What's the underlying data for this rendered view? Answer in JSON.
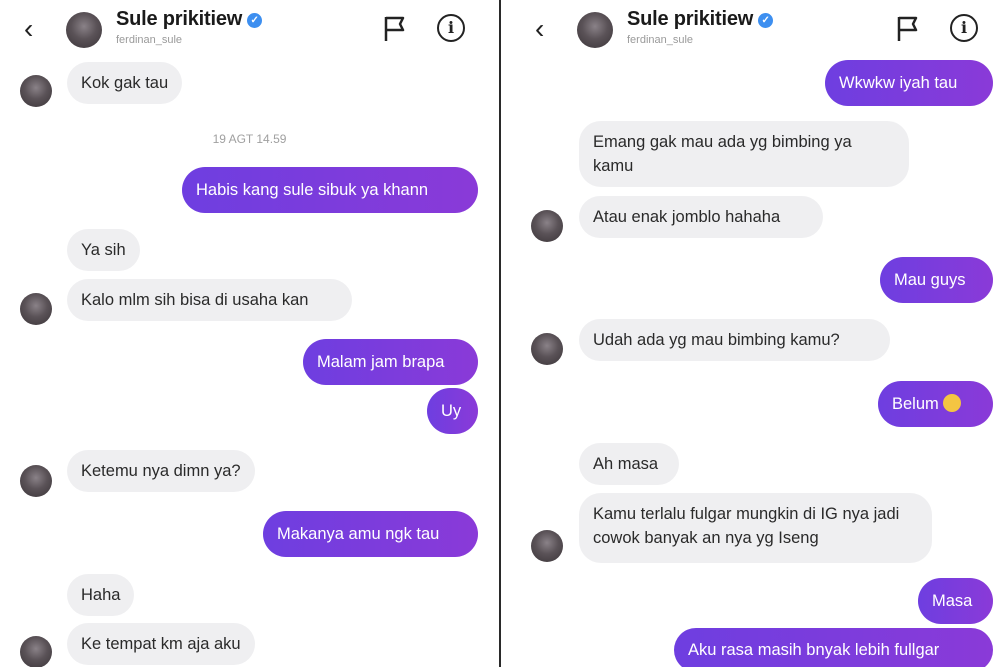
{
  "contact": {
    "name": "Sule prikitiew",
    "username": "ferdinan_sule",
    "verified_mark": "✓"
  },
  "icons": {
    "back": "back-chevron-icon",
    "flag": "flag-icon",
    "info": "info-icon",
    "back_glyph": "‹",
    "info_glyph": "i"
  },
  "colors": {
    "outgoing": "#7a3cdc",
    "incoming": "#efeff1",
    "verified": "#3d8ff0"
  },
  "left_panel": {
    "m1": "Kok gak tau",
    "timestamp": "19 AGT 14.59",
    "m2": "Habis kang sule sibuk ya khann",
    "m3": "Ya sih",
    "m4": "Kalo mlm sih bisa di usaha kan",
    "m5": "Malam jam brapa",
    "m6": "Uy",
    "m7": "Ketemu nya dimn ya?",
    "m8": "Makanya amu ngk tau",
    "m9": "Haha",
    "m10": "Ke tempat km aja aku"
  },
  "right_panel": {
    "m1": "Wkwkw iyah tau",
    "m2": "Emang gak mau ada yg bimbing ya kamu",
    "m3": "Atau enak jomblo hahaha",
    "m4": "Mau guys",
    "m5": "Udah ada yg mau bimbing kamu?",
    "m6": "Belum",
    "m7": "Ah masa",
    "m8": "Kamu terlalu fulgar mungkin di IG nya jadi cowok banyak an nya yg Iseng",
    "m9": "Masa",
    "m10": "Aku rasa masih bnyak lebih fullgar"
  }
}
